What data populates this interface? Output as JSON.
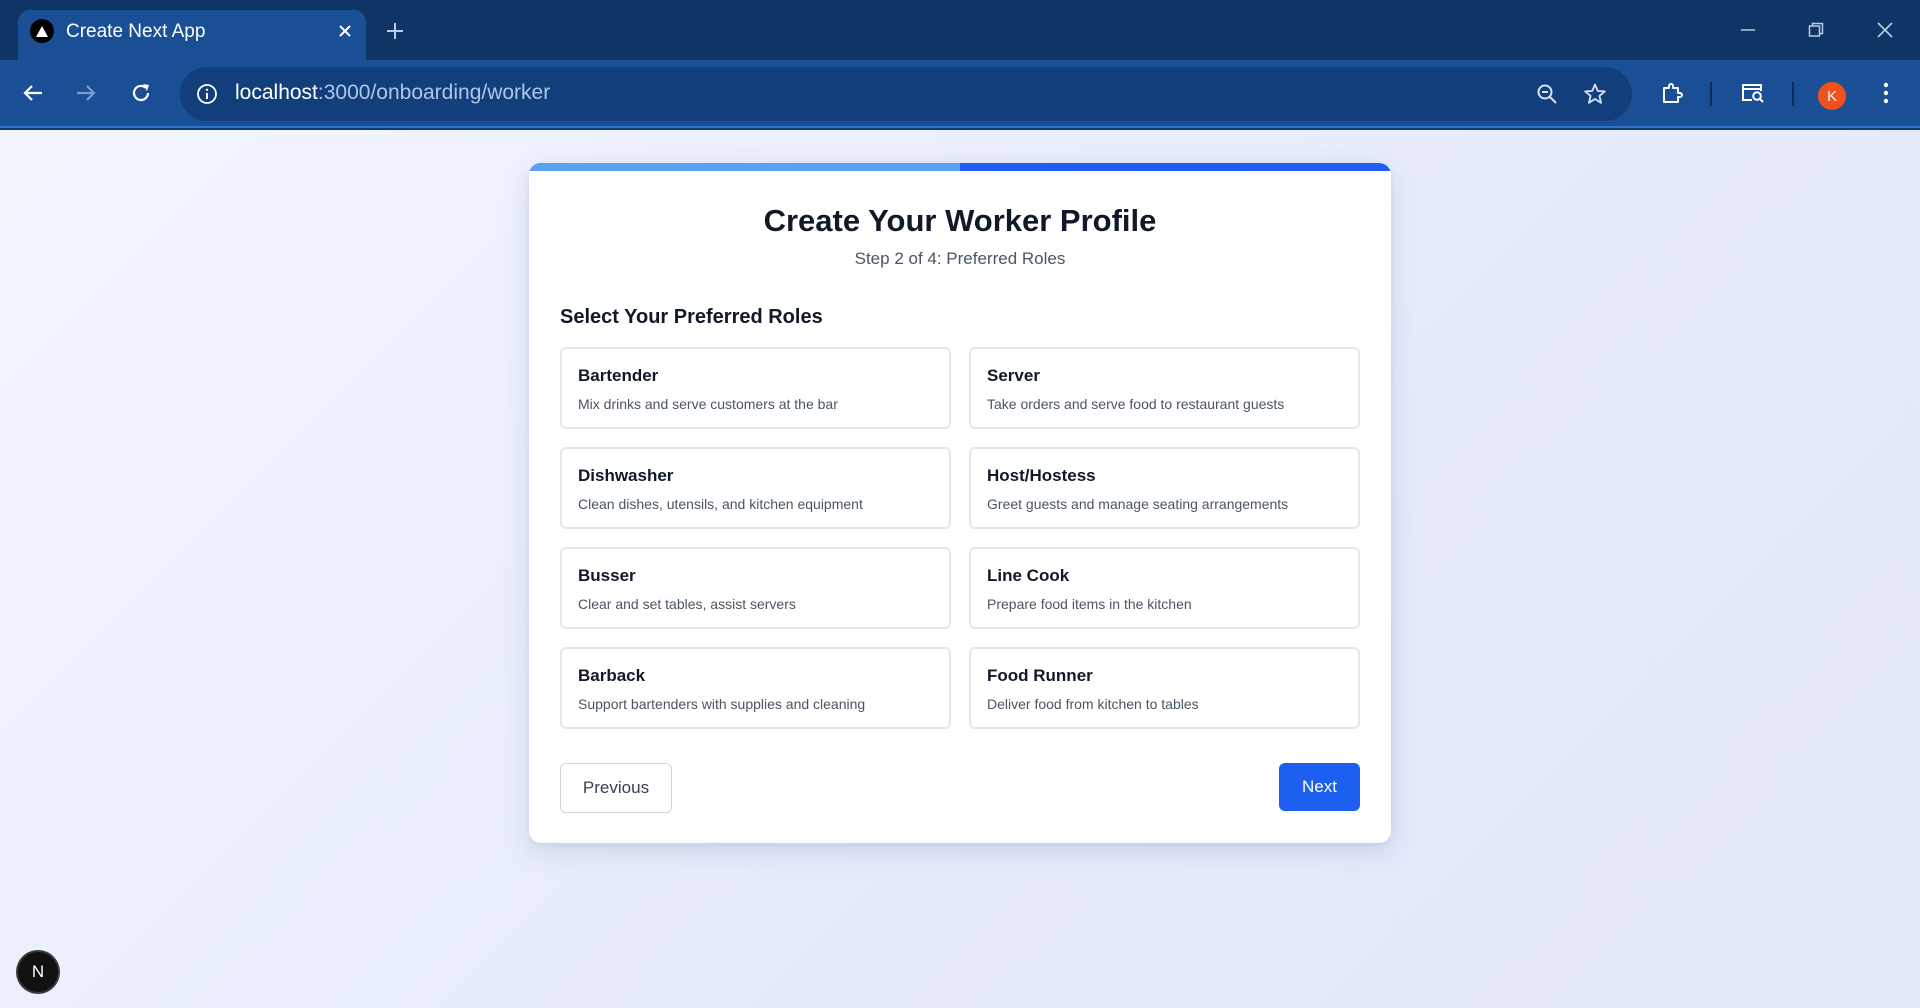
{
  "browser": {
    "tab_title": "Create Next App",
    "url_host": "localhost",
    "url_path": ":3000/onboarding/worker",
    "profile_initial": "K"
  },
  "progress": {
    "step": 2,
    "total": 4,
    "fraction": 0.5
  },
  "page": {
    "title": "Create Your Worker Profile",
    "subtitle": "Step 2 of 4: Preferred Roles",
    "section_title": "Select Your Preferred Roles",
    "roles": [
      {
        "name": "Bartender",
        "description": "Mix drinks and serve customers at the bar"
      },
      {
        "name": "Server",
        "description": "Take orders and serve food to restaurant guests"
      },
      {
        "name": "Dishwasher",
        "description": "Clean dishes, utensils, and kitchen equipment"
      },
      {
        "name": "Host/Hostess",
        "description": "Greet guests and manage seating arrangements"
      },
      {
        "name": "Busser",
        "description": "Clear and set tables, assist servers"
      },
      {
        "name": "Line Cook",
        "description": "Prepare food items in the kitchen"
      },
      {
        "name": "Barback",
        "description": "Support bartenders with supplies and cleaning"
      },
      {
        "name": "Food Runner",
        "description": "Deliver food from kitchen to tables"
      }
    ],
    "previous_label": "Previous",
    "next_label": "Next"
  },
  "dev_badge": "N",
  "colors": {
    "primary": "#1d5ff0",
    "progress_fill": "#5aa1f2",
    "chrome_dark": "#0f3567",
    "chrome_toolbar": "#1a4f96",
    "avatar": "#f0511c"
  }
}
